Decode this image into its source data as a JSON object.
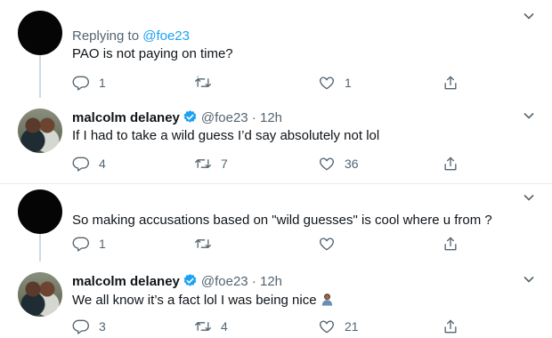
{
  "tweets": [
    {
      "replying_label": "Replying to ",
      "replying_handle": "@foe23",
      "text": "PAO is not paying on time?",
      "replies": "1",
      "retweets": "",
      "likes": "1"
    },
    {
      "name": "malcolm delaney",
      "handle": "@foe23",
      "separator": "·",
      "time": "12h",
      "text": "If I had to take a wild guess I’d say absolutely not lol",
      "replies": "4",
      "retweets": "7",
      "likes": "36"
    },
    {
      "text": "So making accusations based on \"wild guesses\" is cool where u from ?",
      "replies": "1",
      "retweets": "",
      "likes": ""
    },
    {
      "name": "malcolm delaney",
      "handle": "@foe23",
      "separator": "·",
      "time": "12h",
      "text": "We all know it’s a fact lol I was being nice",
      "emoji": "person-bowing-emoji",
      "replies": "3",
      "retweets": "4",
      "likes": "21"
    }
  ],
  "colors": {
    "accent": "#1da1f2",
    "secondary_text": "#536471",
    "thread_line": "#cfd9de",
    "verified": "#1da1f2"
  },
  "icons": [
    "reply-icon",
    "retweet-icon",
    "like-icon",
    "share-icon",
    "chevron-down-icon",
    "verified-badge-icon"
  ]
}
